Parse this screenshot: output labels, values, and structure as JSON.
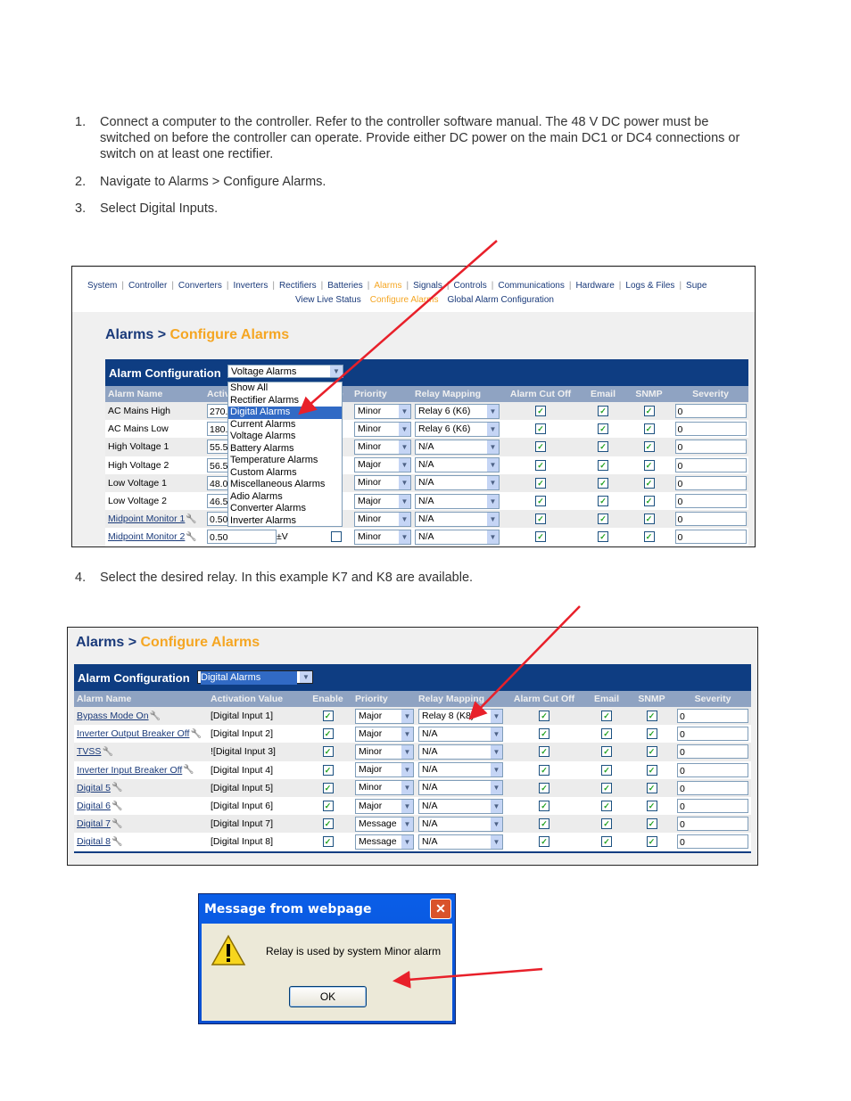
{
  "steps": [
    {
      "num": "1.",
      "text": "Connect a computer to the controller. Refer to the controller software manual. The 48 V DC power must be switched on before the controller can operate. Provide either DC power on the main DC1 or DC4 connections or switch on at least one rectifier."
    },
    {
      "num": "2.",
      "text": "Navigate to Alarms > Configure Alarms."
    },
    {
      "num": "3.",
      "text": "Select Digital Inputs."
    },
    {
      "num": "4.",
      "text": "Select the desired relay. In this example K7 and K8 are available."
    }
  ],
  "nav": {
    "items": [
      "System",
      "Controller",
      "Converters",
      "Inverters",
      "Rectifiers",
      "Batteries",
      "Alarms",
      "Signals",
      "Controls",
      "Communications",
      "Hardware",
      "Logs & Files",
      "Supe"
    ],
    "active": "Alarms",
    "sub": [
      "View Live Status",
      "Configure Alarms",
      "Global Alarm Configuration"
    ],
    "sub_active": "Configure Alarms"
  },
  "breadcrumb": {
    "parent": "Alarms",
    "sep": " > ",
    "current": "Configure Alarms"
  },
  "colors": {
    "header_blue": "#0e3d82",
    "accent_orange": "#f5a623",
    "arrow_red": "#e8202a"
  },
  "shot1": {
    "label": "Alarm Configuration",
    "selected": "Voltage Alarms",
    "columns": [
      "Alarm Name",
      "Activation Value",
      "Enable",
      "Priority",
      "Relay Mapping",
      "Alarm Cut Off",
      "Email",
      "SNMP",
      "Severity"
    ],
    "dropdown_options": [
      "Show All",
      "Rectifier Alarms",
      "Digital Alarms",
      "Current Alarms",
      "Voltage Alarms",
      "Battery Alarms",
      "Temperature Alarms",
      "Custom Alarms",
      "Miscellaneous Alarms",
      "Adio Alarms",
      "Converter Alarms",
      "Inverter Alarms"
    ],
    "dropdown_highlighted": "Digital Alarms",
    "rows": [
      {
        "name": "AC Mains High",
        "link": false,
        "value": "270.",
        "unit": "",
        "enable": false,
        "priority": "Minor",
        "relay": "Relay 6 (K6)",
        "cutoff": true,
        "email": true,
        "snmp": true,
        "severity": "0"
      },
      {
        "name": "AC Mains Low",
        "link": false,
        "value": "180.",
        "unit": "",
        "enable": false,
        "priority": "Minor",
        "relay": "Relay 6 (K6)",
        "cutoff": true,
        "email": true,
        "snmp": true,
        "severity": "0"
      },
      {
        "name": "High Voltage 1",
        "link": false,
        "value": "55.5",
        "unit": "",
        "enable": false,
        "priority": "Minor",
        "relay": "N/A",
        "cutoff": true,
        "email": true,
        "snmp": true,
        "severity": "0"
      },
      {
        "name": "High Voltage 2",
        "link": false,
        "value": "56.5",
        "unit": "",
        "enable": false,
        "priority": "Major",
        "relay": "N/A",
        "cutoff": true,
        "email": true,
        "snmp": true,
        "severity": "0"
      },
      {
        "name": "Low Voltage 1",
        "link": false,
        "value": "48.0",
        "unit": "",
        "enable": false,
        "priority": "Minor",
        "relay": "N/A",
        "cutoff": true,
        "email": true,
        "snmp": true,
        "severity": "0"
      },
      {
        "name": "Low Voltage 2",
        "link": false,
        "value": "46.5",
        "unit": "",
        "enable": false,
        "priority": "Major",
        "relay": "N/A",
        "cutoff": true,
        "email": true,
        "snmp": true,
        "severity": "0"
      },
      {
        "name": "Midpoint Monitor 1",
        "link": true,
        "value": "0.50",
        "unit": "",
        "enable": false,
        "priority": "Minor",
        "relay": "N/A",
        "cutoff": true,
        "email": true,
        "snmp": true,
        "severity": "0"
      },
      {
        "name": "Midpoint Monitor 2",
        "link": true,
        "value": "0.50",
        "unit": "±V",
        "enable": false,
        "priority": "Minor",
        "relay": "N/A",
        "cutoff": true,
        "email": true,
        "snmp": true,
        "severity": "0"
      }
    ]
  },
  "shot2": {
    "label": "Alarm Configuration",
    "selected": "Digital Alarms",
    "columns": [
      "Alarm Name",
      "Activation Value",
      "Enable",
      "Priority",
      "Relay Mapping",
      "Alarm Cut Off",
      "Email",
      "SNMP",
      "Severity"
    ],
    "rows": [
      {
        "name": "Bypass Mode On",
        "value": "[Digital Input 1]",
        "enable": true,
        "priority": "Major",
        "relay": "Relay 8 (K8)",
        "cutoff": true,
        "email": true,
        "snmp": true,
        "severity": "0"
      },
      {
        "name": "Inverter Output Breaker Off",
        "value": "[Digital Input 2]",
        "enable": true,
        "priority": "Major",
        "relay": "N/A",
        "cutoff": true,
        "email": true,
        "snmp": true,
        "severity": "0"
      },
      {
        "name": "TVSS",
        "value": "![Digital Input 3]",
        "enable": true,
        "priority": "Minor",
        "relay": "N/A",
        "cutoff": true,
        "email": true,
        "snmp": true,
        "severity": "0"
      },
      {
        "name": "Inverter Input Breaker Off",
        "value": "[Digital Input 4]",
        "enable": true,
        "priority": "Major",
        "relay": "N/A",
        "cutoff": true,
        "email": true,
        "snmp": true,
        "severity": "0"
      },
      {
        "name": "Digital 5",
        "value": "[Digital Input 5]",
        "enable": true,
        "priority": "Minor",
        "relay": "N/A",
        "cutoff": true,
        "email": true,
        "snmp": true,
        "severity": "0"
      },
      {
        "name": "Digital 6",
        "value": "[Digital Input 6]",
        "enable": true,
        "priority": "Major",
        "relay": "N/A",
        "cutoff": true,
        "email": true,
        "snmp": true,
        "severity": "0"
      },
      {
        "name": "Digital 7",
        "value": "[Digital Input 7]",
        "enable": true,
        "priority": "Message",
        "relay": "N/A",
        "cutoff": true,
        "email": true,
        "snmp": true,
        "severity": "0"
      },
      {
        "name": "Digital 8",
        "value": "[Digital Input 8]",
        "enable": true,
        "priority": "Message",
        "relay": "N/A",
        "cutoff": true,
        "email": true,
        "snmp": true,
        "severity": "0"
      }
    ]
  },
  "dialog": {
    "title": "Message from webpage",
    "message": "Relay is used by system Minor alarm",
    "ok_label": "OK",
    "close_icon": "close-icon",
    "warning_icon": "warning-icon"
  }
}
